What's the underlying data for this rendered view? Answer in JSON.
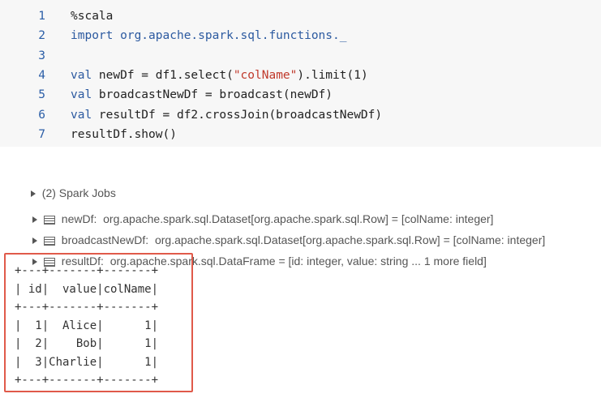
{
  "code_cell": {
    "lines": [
      {
        "num": "1",
        "segments": [
          {
            "t": "%scala",
            "c": "plain"
          }
        ]
      },
      {
        "num": "2",
        "segments": [
          {
            "t": "import",
            "c": "kw"
          },
          {
            "t": " org.apache.spark.sql.functions._",
            "c": "kw"
          }
        ]
      },
      {
        "num": "3",
        "segments": []
      },
      {
        "num": "4",
        "segments": [
          {
            "t": "val",
            "c": "kw"
          },
          {
            "t": " newDf = df1.select(",
            "c": "plain"
          },
          {
            "t": "\"colName\"",
            "c": "str"
          },
          {
            "t": ").limit(1)",
            "c": "plain"
          }
        ]
      },
      {
        "num": "5",
        "segments": [
          {
            "t": "val",
            "c": "kw"
          },
          {
            "t": " broadcastNewDf = broadcast(newDf)",
            "c": "plain"
          }
        ]
      },
      {
        "num": "6",
        "segments": [
          {
            "t": "val",
            "c": "kw"
          },
          {
            "t": " resultDf = df2.crossJoin(broadcastNewDf)",
            "c": "plain"
          }
        ]
      },
      {
        "num": "7",
        "segments": [
          {
            "t": "resultDf.show()",
            "c": "plain"
          }
        ]
      }
    ]
  },
  "output": {
    "spark_jobs_label": "(2) Spark Jobs",
    "variables": [
      {
        "name": "newDf:",
        "type": "org.apache.spark.sql.Dataset[org.apache.spark.sql.Row] = [colName: integer]"
      },
      {
        "name": "broadcastNewDf:",
        "type": "org.apache.spark.sql.Dataset[org.apache.spark.sql.Row] = [colName: integer]"
      },
      {
        "name": "resultDf:",
        "type": "org.apache.spark.sql.DataFrame = [id: integer, value: string ... 1 more field]"
      }
    ],
    "result_table": "+---+-------+-------+\n| id|  value|colName|\n+---+-------+-------+\n|  1|  Alice|      1|\n|  2|    Bob|      1|\n|  3|Charlie|      1|\n+---+-------+-------+"
  },
  "colors": {
    "highlight_border": "#e05a4a",
    "keyword": "#2c5aa0",
    "string": "#c0392b"
  }
}
